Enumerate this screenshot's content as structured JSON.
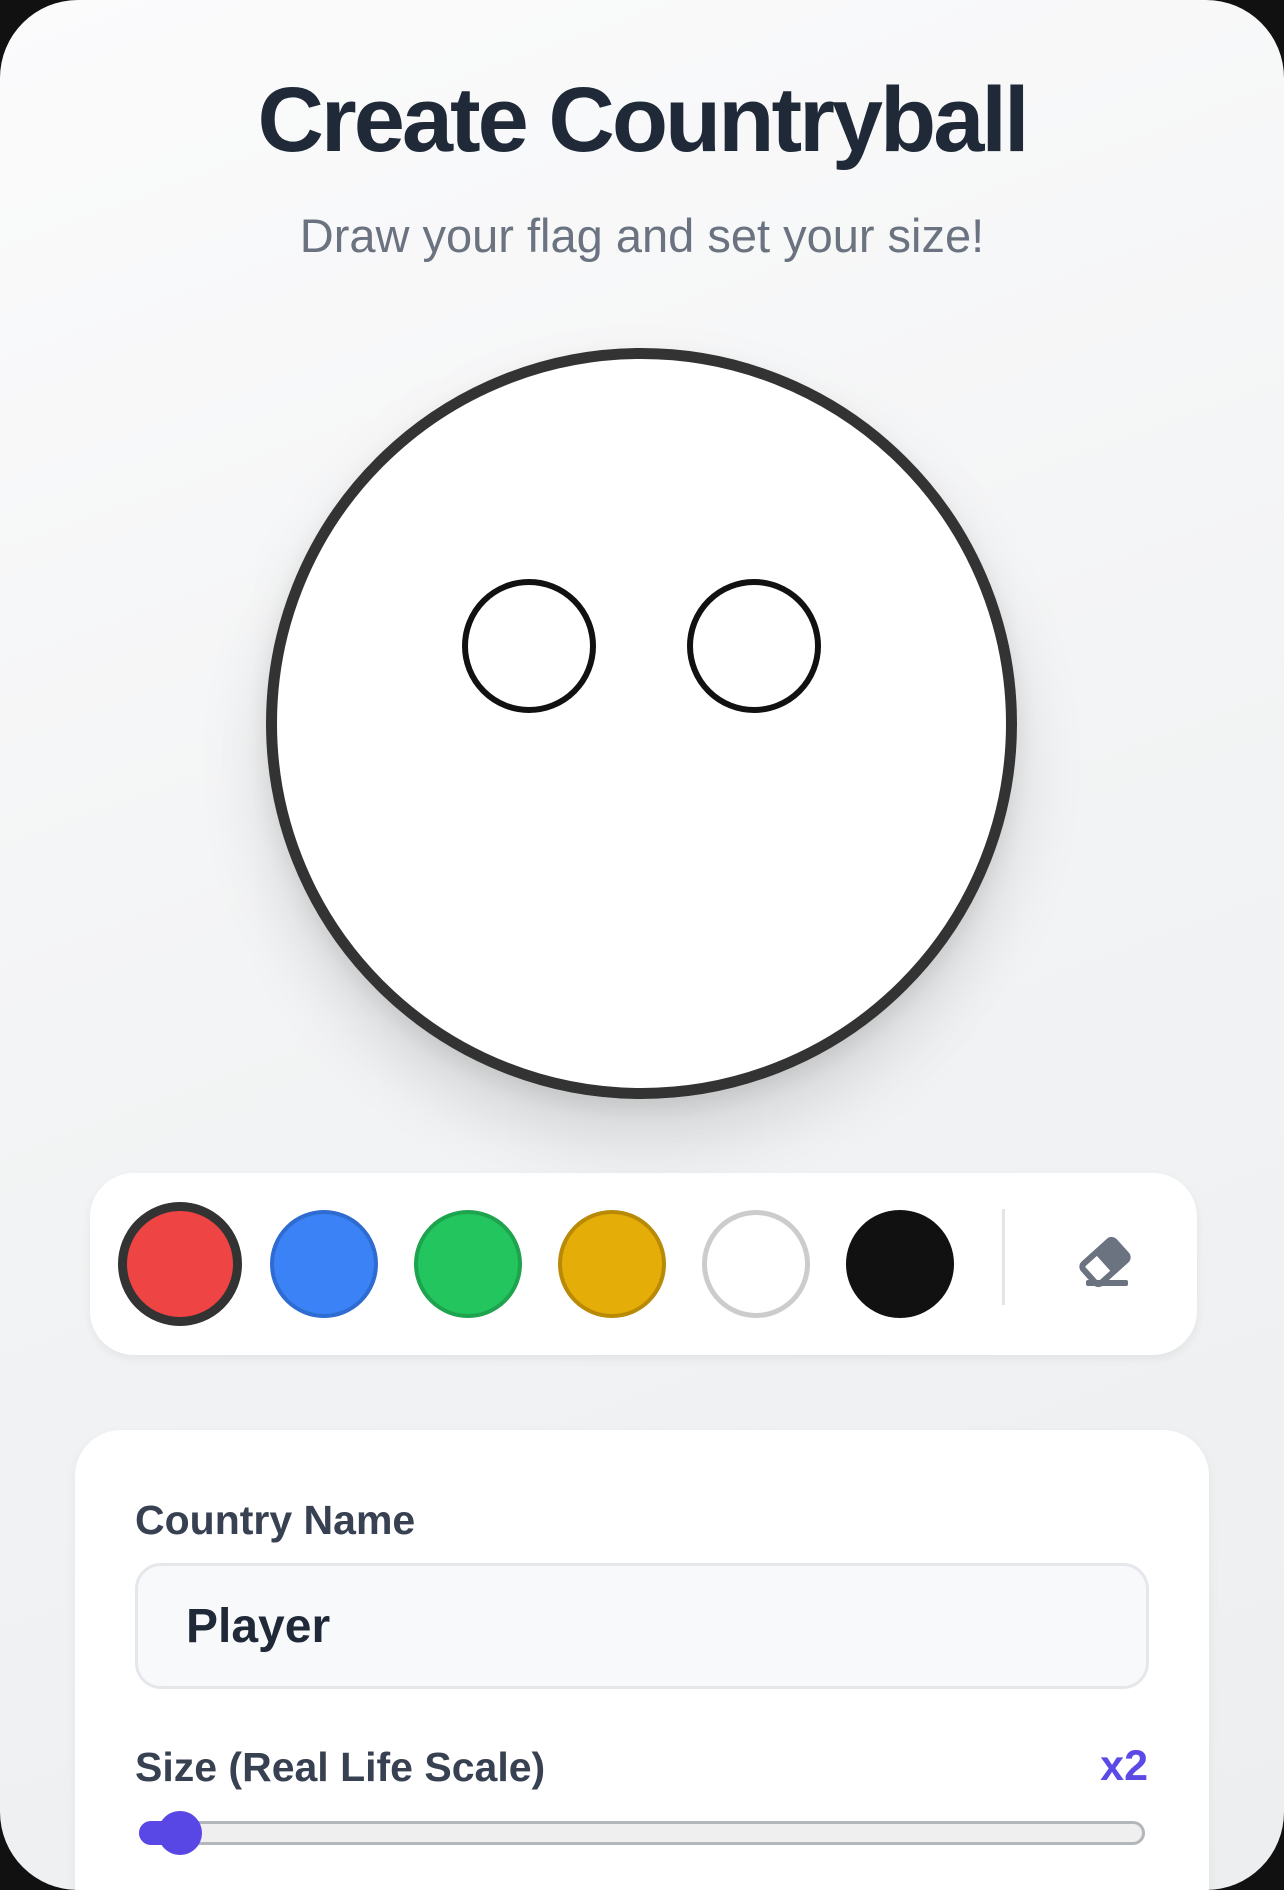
{
  "header": {
    "title": "Create Countryball",
    "subtitle": "Draw your flag and set your size!"
  },
  "palette": {
    "colors": [
      {
        "name": "red",
        "hex": "#ef4444",
        "border": "#333333",
        "selected": true
      },
      {
        "name": "blue",
        "hex": "#3b82f6",
        "border": "#2f6cd1",
        "selected": false
      },
      {
        "name": "green",
        "hex": "#22c55e",
        "border": "#1ea34f",
        "selected": false
      },
      {
        "name": "yellow",
        "hex": "#e5ad07",
        "border": "#b98a06",
        "selected": false
      },
      {
        "name": "white",
        "hex": "#ffffff",
        "border": "#cccccc",
        "selected": false
      },
      {
        "name": "black",
        "hex": "#111111",
        "border": "#111111",
        "selected": false
      }
    ],
    "eraser_icon": "eraser-icon"
  },
  "form": {
    "name_label": "Country Name",
    "name_value": "Player",
    "size_label": "Size (Real Life Scale)",
    "size_value": "x2",
    "size_fraction": 0.02
  },
  "colors": {
    "accent": "#5b4ae6",
    "ball_outline": "#333333",
    "text_primary": "#1f2937",
    "text_secondary": "#6b7280"
  }
}
